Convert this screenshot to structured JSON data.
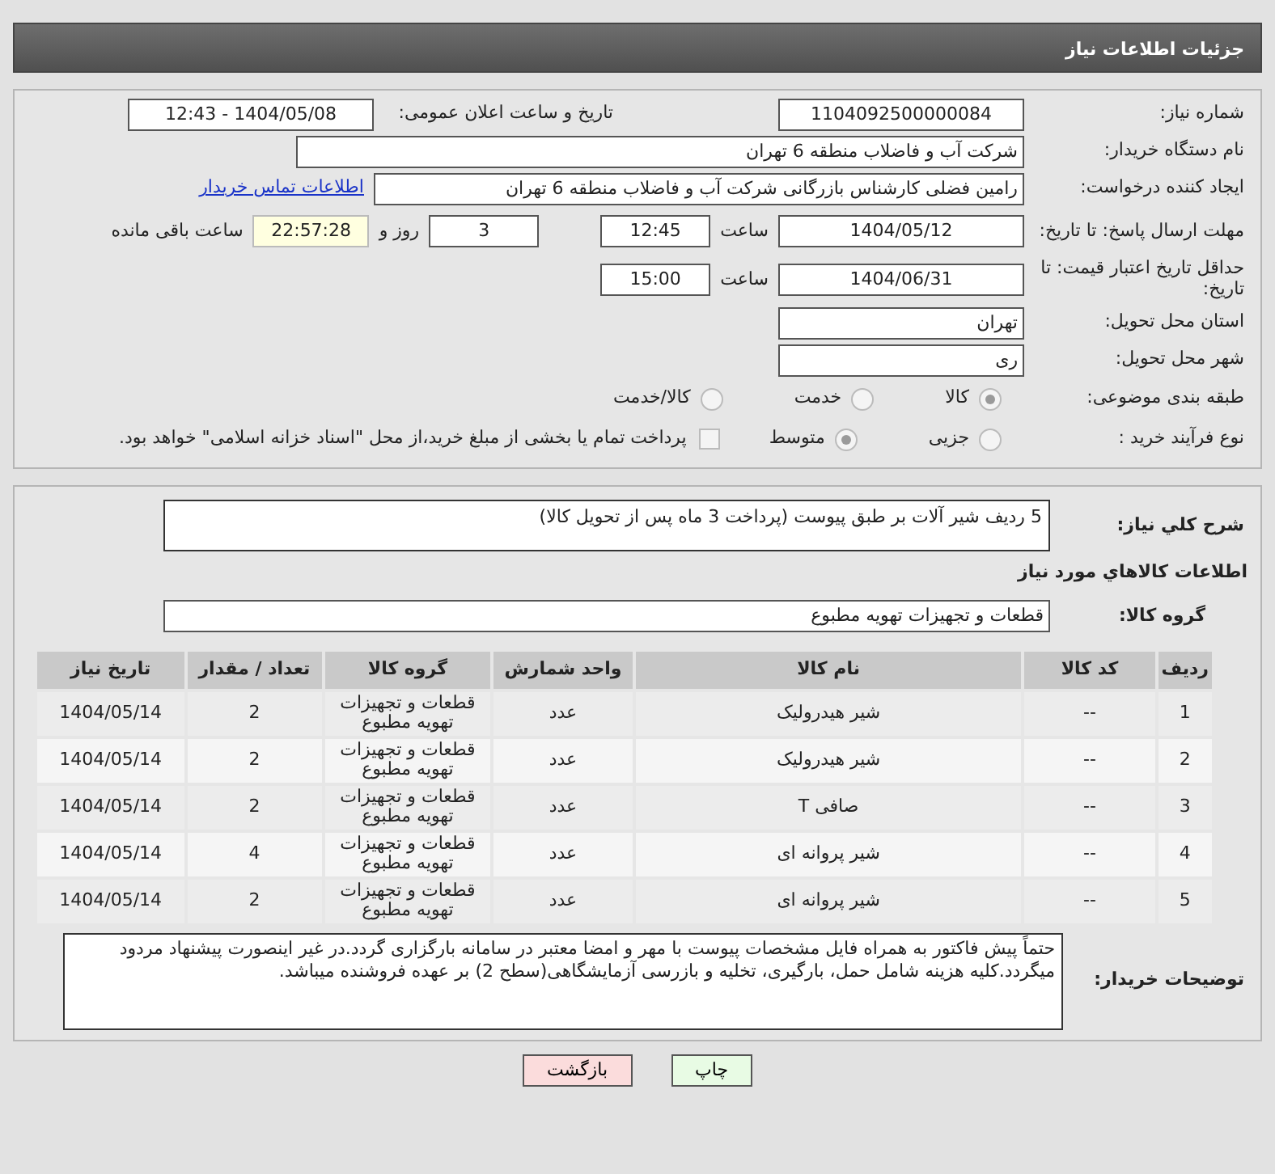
{
  "header": {
    "title": "جزئیات اطلاعات نیاز"
  },
  "need_number": {
    "label": "شماره نیاز:",
    "value": "1104092500000084"
  },
  "announce": {
    "label": "تاریخ و ساعت اعلان عمومی:",
    "value": "1404/05/08 - 12:43"
  },
  "buyer_org": {
    "label": "نام دستگاه خریدار:",
    "value": "شرکت آب و فاضلاب منطقه 6 تهران"
  },
  "requester": {
    "label": "ایجاد کننده درخواست:",
    "value": "رامین  فضلی کارشناس بازرگانی شرکت آب و فاضلاب منطقه 6 تهران",
    "link": "اطلاعات تماس خریدار"
  },
  "deadline": {
    "label": "مهلت ارسال پاسخ: تا تاریخ:",
    "date": "1404/05/12",
    "time_label": "ساعت",
    "time": "12:45",
    "days": "3",
    "days_label": "روز و",
    "remaining": "22:57:28",
    "remaining_label": "ساعت باقی مانده"
  },
  "validity": {
    "label": "حداقل تاریخ اعتبار قیمت: تا تاریخ:",
    "date": "1404/06/31",
    "time_label": "ساعت",
    "time": "15:00"
  },
  "province": {
    "label": "استان محل تحویل:",
    "value": "تهران"
  },
  "city": {
    "label": "شهر محل تحویل:",
    "value": "ری"
  },
  "category": {
    "label": "طبقه بندی موضوعی:",
    "options": [
      {
        "label": "کالا",
        "selected": true
      },
      {
        "label": "خدمت",
        "selected": false
      },
      {
        "label": "کالا/خدمت",
        "selected": false
      }
    ]
  },
  "purchase_type": {
    "label": "نوع فرآیند خرید :",
    "options": [
      {
        "label": "جزیی",
        "selected": false
      },
      {
        "label": "متوسط",
        "selected": true
      }
    ],
    "payment_checkbox": {
      "label": "پرداخت تمام یا بخشی از مبلغ خرید،از محل \"اسناد خزانه اسلامی\" خواهد بود.",
      "checked": false
    }
  },
  "description": {
    "label": "شرح کلي نياز:",
    "value": "5 ردیف شیر آلات بر طبق پیوست (پرداخت 3 ماه پس از تحویل کالا)"
  },
  "goods_title": "اطلاعات کالاهاي مورد نياز",
  "goods_group": {
    "label": "گروه کالا:",
    "value": "قطعات و تجهیزات تهویه مطبوع"
  },
  "table": {
    "columns": [
      "ردیف",
      "کد کالا",
      "نام کالا",
      "واحد شمارش",
      "گروه کالا",
      "تعداد / مقدار",
      "تاریخ نیاز"
    ],
    "rows": [
      [
        "1",
        "--",
        "شیر هیدرولیک",
        "عدد",
        "قطعات و تجهیزات تهویه مطبوع",
        "2",
        "1404/05/14"
      ],
      [
        "2",
        "--",
        "شیر هیدرولیک",
        "عدد",
        "قطعات و تجهیزات تهویه مطبوع",
        "2",
        "1404/05/14"
      ],
      [
        "3",
        "--",
        "صافی T",
        "عدد",
        "قطعات و تجهیزات تهویه مطبوع",
        "2",
        "1404/05/14"
      ],
      [
        "4",
        "--",
        "شیر پروانه ای",
        "عدد",
        "قطعات و تجهیزات تهویه مطبوع",
        "4",
        "1404/05/14"
      ],
      [
        "5",
        "--",
        "شیر پروانه ای",
        "عدد",
        "قطعات و تجهیزات تهویه مطبوع",
        "2",
        "1404/05/14"
      ]
    ]
  },
  "buyer_notes": {
    "label": "توضیحات خریدار:",
    "value": "حتماً پیش فاکتور به همراه فایل مشخصات پیوست با مهر و امضا معتبر در سامانه بارگزاری گردد.در غیر اینصورت پیشنهاد مردود میگردد.کلیه هزینه شامل حمل، بارگیری، تخلیه و بازرسی آزمایشگاهی(سطح 2) بر عهده فروشنده میباشد."
  },
  "buttons": [
    {
      "label": "چاپ",
      "kind": "print"
    },
    {
      "label": "بازگشت",
      "kind": "back"
    }
  ]
}
